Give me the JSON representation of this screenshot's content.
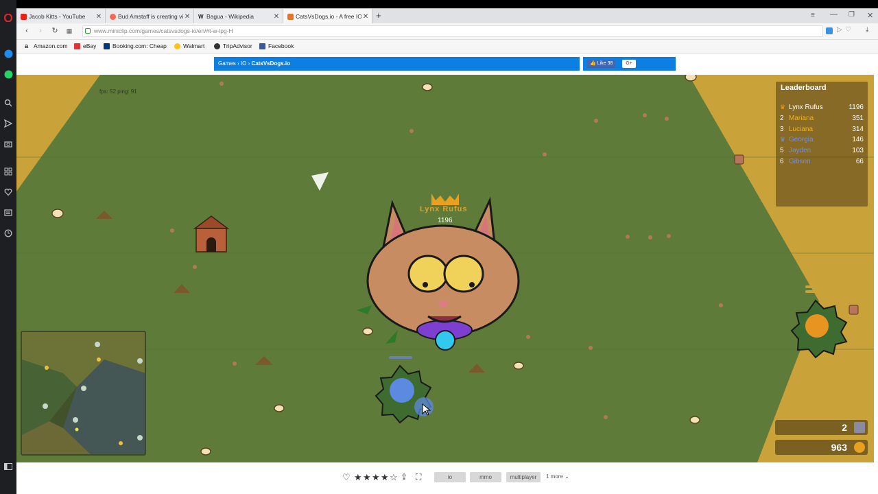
{
  "tabs": [
    {
      "title": "Jacob Kitts - YouTube",
      "favicon_color": "#e62117"
    },
    {
      "title": "Bud Amstaff is creating vi",
      "favicon_color": "#f96854"
    },
    {
      "title": "Bagua - Wikipedia",
      "favicon_glyph": "W"
    },
    {
      "title": "CatsVsDogs.io - A free IO",
      "favicon_color": "#e8742a"
    }
  ],
  "new_tab": "+",
  "url": "www.miniclip.com/games/catsvsdogs-io/en/#t-w-lpg-H",
  "bookmarks": [
    "Amazon.com",
    "eBay",
    "Booking.com: Cheap",
    "Walmart",
    "TripAdvisor",
    "Facebook"
  ],
  "breadcrumb": {
    "part1": "Games",
    "part2": "IO",
    "part3": "CatsVsDogs.io"
  },
  "social": {
    "like": "Like 38",
    "gplus": "G+"
  },
  "game": {
    "fps_text": "fps: 52  ping: 91",
    "player": {
      "name": "Lynx Rufus",
      "score": "1196"
    },
    "leaderboard": {
      "title": "Leaderboard",
      "rows": [
        {
          "rank": "",
          "name": "Lynx Rufus",
          "score": "1196",
          "color": "#ffffff",
          "crown": true
        },
        {
          "rank": "2",
          "name": "Mariana",
          "score": "351",
          "color": "#f0b429"
        },
        {
          "rank": "3",
          "name": "Luciana",
          "score": "314",
          "color": "#f0b429"
        },
        {
          "rank": "",
          "name": "Georgia",
          "score": "146",
          "color": "#6f8fe8",
          "crown": true
        },
        {
          "rank": "5",
          "name": "Jayden",
          "score": "103",
          "color": "#6f8fe8"
        },
        {
          "rank": "6",
          "name": "Gibson",
          "score": "66",
          "color": "#6f8fe8"
        }
      ]
    },
    "kennels": "2",
    "coins": "963"
  },
  "bottom": {
    "tags": [
      "io",
      "mmo",
      "multiplayer"
    ],
    "more": "1 more",
    "rating": 4
  },
  "colors": {
    "grass": "#5f7b3a",
    "sand": "#c9a33a",
    "accent_blue": "#0d7fe3"
  }
}
